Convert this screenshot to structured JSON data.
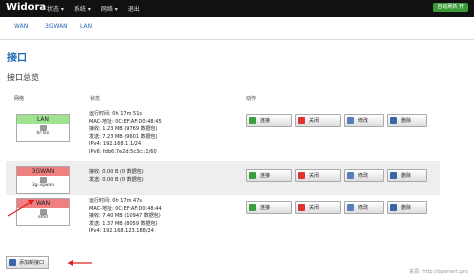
{
  "navbar": {
    "brand": "Widora",
    "menu": [
      "状态 ▾",
      "系统 ▾",
      "网络 ▾",
      "退出"
    ],
    "auto_refresh": "自动刷新 开"
  },
  "tabs": [
    "WAN",
    "3GWAN",
    "LAN"
  ],
  "page_title": "接口",
  "section_title": "接口总览",
  "table": {
    "headers": {
      "network": "网络",
      "status": "状态",
      "actions": "动作"
    },
    "rows": [
      {
        "name": "LAN",
        "device": "br-lan",
        "color": "#9fe38f",
        "status": [
          "运行时间: 0h 17m 51s",
          "MAC-地址: 0C:EF:AF:D0:48:45",
          "接收: 1.23 MB (9769 数据包)",
          "发送: 7.23 MB (9601 数据包)",
          "IPv4: 192.168.1.1/24",
          "IPv6: fdb6:7e2d:5c3c::1/60"
        ]
      },
      {
        "name": "3GWAN",
        "device": "3g-3gwan",
        "color": "#f08080",
        "status": [
          "接收: 0.00 B (0 数据包)",
          "发送: 0.00 B (0 数据包)"
        ]
      },
      {
        "name": "WAN",
        "device": "eth0",
        "color": "#f08080",
        "status": [
          "运行时间: 0h 17m 47s",
          "MAC-地址: 0C:EF:AF:D0:48:44",
          "接收: 7.40 MB (10947 数据包)",
          "发送: 1.37 MB (8059 数据包)",
          "IPv4: 192.168.123.188/24"
        ]
      }
    ],
    "buttons": {
      "connect": "连接",
      "close": "关闭",
      "edit": "修改",
      "delete": "删除"
    }
  },
  "add_interface_label": "添加新接口",
  "watermark": "来源: http://openwrt.pro"
}
